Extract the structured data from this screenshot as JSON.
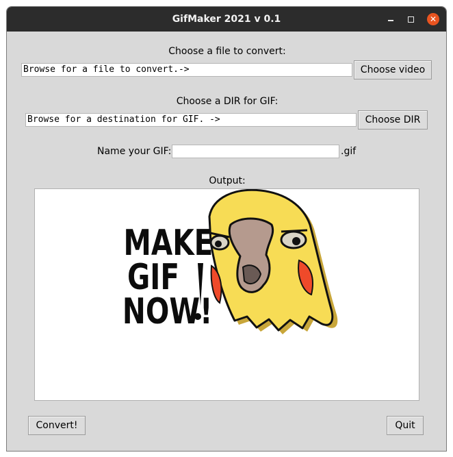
{
  "window": {
    "title": "GifMaker 2021 v 0.1",
    "close_symbol": "✕"
  },
  "file_section": {
    "label": "Choose a file to convert:",
    "input_value": "Browse for a file to convert.->",
    "button_label": "Choose video"
  },
  "dir_section": {
    "label": "Choose a DIR for GIF:",
    "input_value": "Browse for a destination for GIF. ->",
    "button_label": "Choose DIR"
  },
  "name_section": {
    "label": "Name your GIF:",
    "input_value": "",
    "suffix": ".gif"
  },
  "output": {
    "label": "Output:",
    "image": {
      "icon": "make-gif-now-parrot-logo",
      "text_lines": [
        "MAKE",
        "GIF",
        "NOW!"
      ]
    }
  },
  "actions": {
    "convert_label": "Convert!",
    "quit_label": "Quit"
  },
  "colors": {
    "titlebar": "#2c2c2c",
    "window_bg": "#d9d9d9",
    "close_button": "#e95420",
    "parrot_yellow": "#f7dc55",
    "parrot_shadow": "#c8a63a",
    "parrot_cheek": "#ef4a2a",
    "parrot_beak": "#b59a8e"
  }
}
